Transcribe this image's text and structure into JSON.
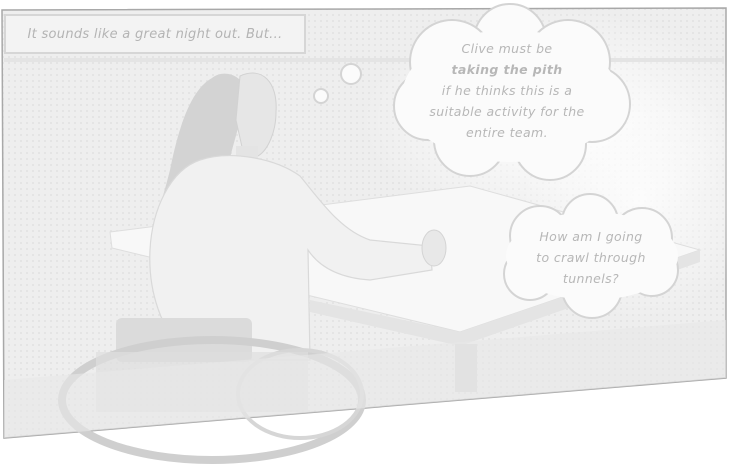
{
  "caption": {
    "text": "It sounds like a great night out. But..."
  },
  "thought_bubble_1": {
    "line1": "Clive must be",
    "emphasis": "taking the pith",
    "line3": "if he thinks this is a",
    "line4": "suitable activity for the",
    "line5": "entire team."
  },
  "thought_bubble_2": {
    "line1": "How am I going",
    "line2": "to crawl through",
    "line3": "tunnels?"
  },
  "colors": {
    "panel_fill": "#efefef",
    "panel_border": "#9e9e9e",
    "bubble_fill": "#fbfbfb",
    "bubble_stroke": "#d4d4d4",
    "text": "#b7b7b7"
  }
}
